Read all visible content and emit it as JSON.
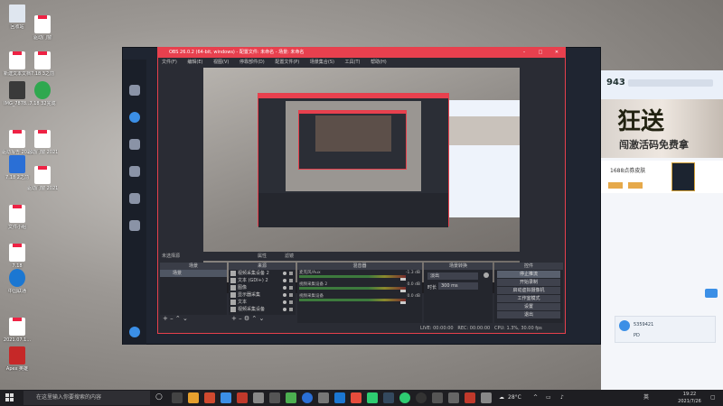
{
  "desktop": {
    "icons": [
      {
        "label": "回收站"
      },
      {
        "label": "驱动门窗"
      },
      {
        "label": "新建文本文档"
      },
      {
        "label": "7.18 3之前"
      },
      {
        "label": "IMG_7878..."
      },
      {
        "label": "7.18 32完成"
      },
      {
        "label": "驱动报告 2021070..."
      },
      {
        "label": "驱动门窗 2021070..."
      },
      {
        "label": "7.18 2之前"
      },
      {
        "label": "驱动门窗 2021.07..."
      },
      {
        "label": "文件小组"
      },
      {
        "label": "7.18"
      },
      {
        "label": "中国联通"
      },
      {
        "label": "2021.07.1..."
      },
      {
        "label": "Apex 英雄"
      }
    ]
  },
  "obs": {
    "title": "OBS 26.0.2 (64-bit, windows) - 配置文件: 未命名 - 场景: 未命名",
    "menu": [
      "文件(F)",
      "编辑(E)",
      "视图(V)",
      "停靠部件(D)",
      "配置文件(P)",
      "场景集合(S)",
      "工具(T)",
      "帮助(H)"
    ],
    "source_bar": {
      "label": "未选择源",
      "props": "属性",
      "filters": "滤镜"
    },
    "scenes": {
      "header": "场景",
      "items": [
        "场景"
      ]
    },
    "sources": {
      "header": "来源",
      "items": [
        "视频采集设备 2",
        "文本 (GDI+) 2",
        "图像",
        "显示器采集",
        "文本",
        "视频采集设备"
      ]
    },
    "mixer": {
      "header": "混音器",
      "channels": [
        {
          "name": "麦克风/Aux",
          "db": "-1.3 dB"
        },
        {
          "name": "视频采集设备 2",
          "db": "0.0 dB"
        },
        {
          "name": "视频采集设备",
          "db": "0.0 dB"
        }
      ]
    },
    "transitions": {
      "header": "场景转换",
      "type": "淡出",
      "duration_label": "时长",
      "duration": "300 ms"
    },
    "controls": {
      "header": "控件",
      "buttons": [
        "停止推流",
        "开始录制",
        "启动虚拟摄像机",
        "工作室模式",
        "设置",
        "退出"
      ]
    },
    "status": {
      "live": "LIVE: 00:00:00",
      "rec": "REC: 00:00:00",
      "cpu": "CPU: 1.3%, 30.00 fps"
    }
  },
  "right_panel": {
    "score": "943",
    "promo_title": "狂送",
    "promo_sub": "闯激活码免费拿",
    "item_label": "1688点券皮肤",
    "badge": "10",
    "user_id": "5359421",
    "chat_hint": "PD"
  },
  "taskbar": {
    "search_placeholder": "在这里输入你要搜索的内容",
    "temperature": "28°C",
    "time": "19:22",
    "date": "2021/7/26",
    "lang": "英"
  }
}
